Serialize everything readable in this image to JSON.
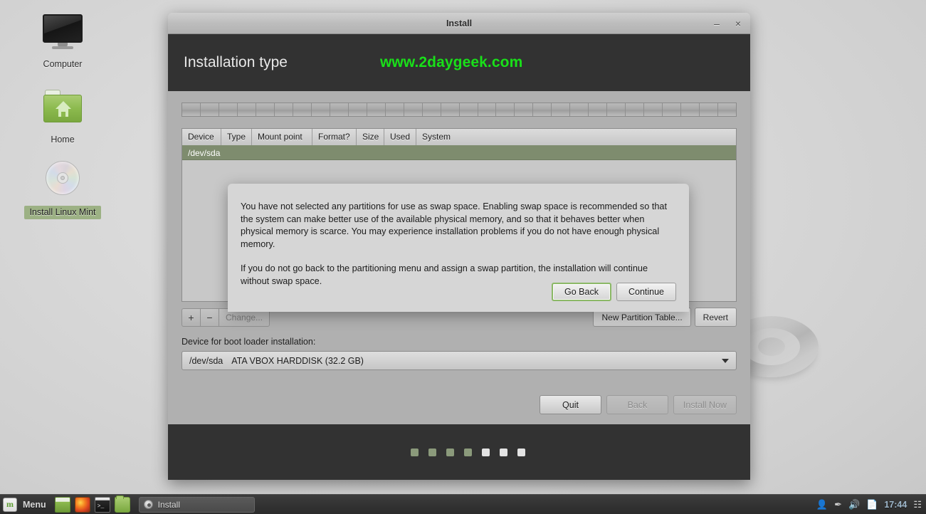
{
  "desktop": {
    "icons": [
      {
        "label": "Computer",
        "icon": "monitor-icon",
        "selected": false
      },
      {
        "label": "Home",
        "icon": "folder-home-icon",
        "selected": false
      },
      {
        "label": "Install Linux Mint",
        "icon": "cd-icon",
        "selected": true
      }
    ]
  },
  "window": {
    "title": "Install",
    "minimize_label": "–",
    "close_label": "×",
    "header_title": "Installation type",
    "watermark": "www.2daygeek.com",
    "watermark_color": "#19e019",
    "header_bg": "#323232"
  },
  "partition_table": {
    "columns": [
      "Device",
      "Type",
      "Mount point",
      "Format?",
      "Size",
      "Used",
      "System"
    ],
    "rows": [
      {
        "device": "/dev/sda",
        "selected": true,
        "selected_color": "#7e8c6e"
      }
    ]
  },
  "toolbar": {
    "add_label": "+",
    "remove_label": "−",
    "change_label": "Change...",
    "new_partition_table_label": "New Partition Table...",
    "revert_label": "Revert"
  },
  "bootloader": {
    "label": "Device for boot loader installation:",
    "selected_device": "/dev/sda",
    "selected_description": "ATA VBOX HARDDISK (32.2 GB)"
  },
  "navigation": {
    "quit_label": "Quit",
    "back_label": "Back",
    "back_disabled": true,
    "install_now_label": "Install Now",
    "install_now_disabled": true
  },
  "progress": {
    "total_steps": 7,
    "completed_steps": 4,
    "done_color": "#8b9a7b",
    "pending_color": "#e3e3e3"
  },
  "dialog": {
    "paragraph1": "You have not selected any partitions for use as swap space. Enabling swap space is recommended so that the system can make better use of the available physical memory, and so that it behaves better when physical memory is scarce. You may experience installation problems if you do not have enough physical memory.",
    "paragraph2": "If you do not go back to the partitioning menu and assign a swap partition, the installation will continue without swap space.",
    "go_back_label": "Go Back",
    "continue_label": "Continue",
    "focus_border_color": "#8bb866"
  },
  "taskbar": {
    "menu_label": "Menu",
    "launchers": [
      {
        "name": "show-desktop-icon"
      },
      {
        "name": "firefox-icon"
      },
      {
        "name": "terminal-icon"
      },
      {
        "name": "file-manager-icon"
      }
    ],
    "windows": [
      {
        "label": "Install",
        "icon": "cd-icon"
      }
    ],
    "tray": [
      "user-icon",
      "update-manager-icon",
      "volume-icon",
      "battery-icon"
    ],
    "clock": "17:44",
    "workspace_icon": "workspace-switcher-icon"
  }
}
